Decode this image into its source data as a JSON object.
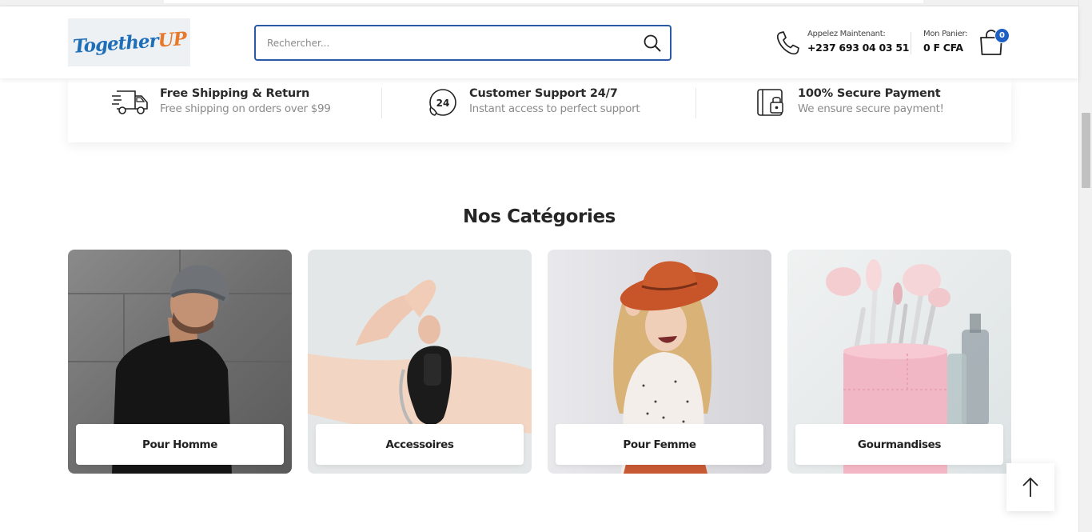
{
  "header": {
    "logo_text_main": "Together",
    "logo_text_accent": "UP",
    "search_placeholder": "Rechercher...",
    "call_label": "Appelez Maintenant:",
    "call_number": "+237 693 04 03 51",
    "cart_label": "Mon Panier:",
    "cart_total": "0 F CFA",
    "cart_count": "0"
  },
  "features": [
    {
      "icon": "truck-icon",
      "title": "Free Shipping & Return",
      "subtitle": "Free shipping on orders over $99"
    },
    {
      "icon": "support-24-icon",
      "title": "Customer Support 24/7",
      "subtitle": "Instant access to perfect support"
    },
    {
      "icon": "secure-wallet-icon",
      "title": "100% Secure Payment",
      "subtitle": "We ensure secure payment!"
    }
  ],
  "categories": {
    "title": "Nos Catégories",
    "items": [
      {
        "label": "Pour Homme"
      },
      {
        "label": "Accessoires"
      },
      {
        "label": "Pour Femme"
      },
      {
        "label": "Gourmandises"
      }
    ]
  },
  "colors": {
    "accent": "#1e5fc4",
    "search_border": "#2a5aa6",
    "logo_blue": "#1f6fb8",
    "logo_orange": "#e8782a"
  }
}
